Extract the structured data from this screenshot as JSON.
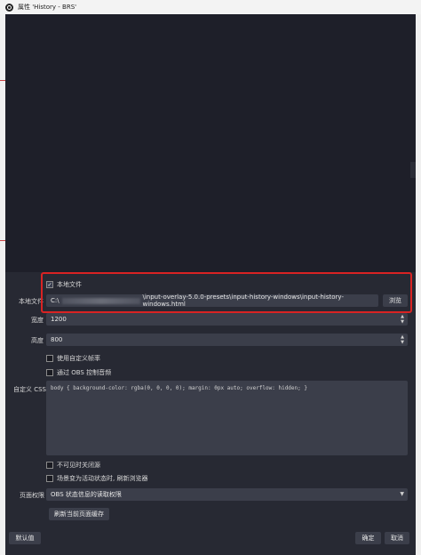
{
  "window": {
    "title": "属性 'History - BRS'"
  },
  "local_file": {
    "checkbox_label": "本地文件",
    "checked": true,
    "field_label": "本地文件",
    "path_prefix": "C:\\",
    "path_suffix": "\\input-overlay-5.0.0-presets\\input-history-windows\\input-history-windows.html",
    "browse_label": "浏览"
  },
  "width": {
    "label": "宽度",
    "value": "1200"
  },
  "height": {
    "label": "高度",
    "value": "800"
  },
  "custom_fps": {
    "label": "使用自定义帧率",
    "checked": false
  },
  "obs_audio": {
    "label": "通过 OBS 控制音频",
    "checked": false
  },
  "custom_css": {
    "label": "自定义 CSS",
    "value": "body { background-color: rgba(0, 0, 0, 0); margin: 0px auto; overflow: hidden; }"
  },
  "shutdown_hidden": {
    "label": "不可见时关闭源",
    "checked": false
  },
  "refresh_active": {
    "label": "场景变为活动状态时, 刷新浏览器",
    "checked": false
  },
  "page_permissions": {
    "label": "页面权限",
    "value": "OBS 状态信息的读取权限"
  },
  "refresh_cache": {
    "label": "刷新当前页面缓存"
  },
  "footer": {
    "defaults_label": "默认值",
    "ok_label": "确定",
    "cancel_label": "取消"
  },
  "colors": {
    "accent_highlight": "#d92323",
    "background": "#272933",
    "input": "#3b3e4a"
  }
}
